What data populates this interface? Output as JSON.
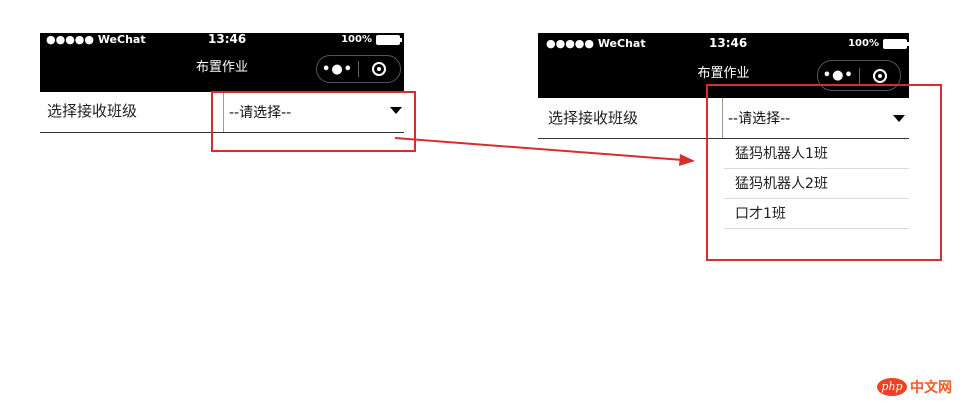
{
  "status_bar": {
    "carrier": "●●●●● WeChat",
    "time": "13:46",
    "battery": "100%"
  },
  "nav": {
    "title": "布置作业",
    "more_icon": "more-dots-icon",
    "close_icon": "target-icon"
  },
  "form": {
    "label": "选择接收班级",
    "select_value": "--请选择--",
    "options": [
      "猛犸机器人1班",
      "猛犸机器人2班",
      "口才1班"
    ]
  },
  "annotation": {
    "color": "#d62d2d"
  },
  "watermark": {
    "badge": "php",
    "text": "中文网"
  }
}
